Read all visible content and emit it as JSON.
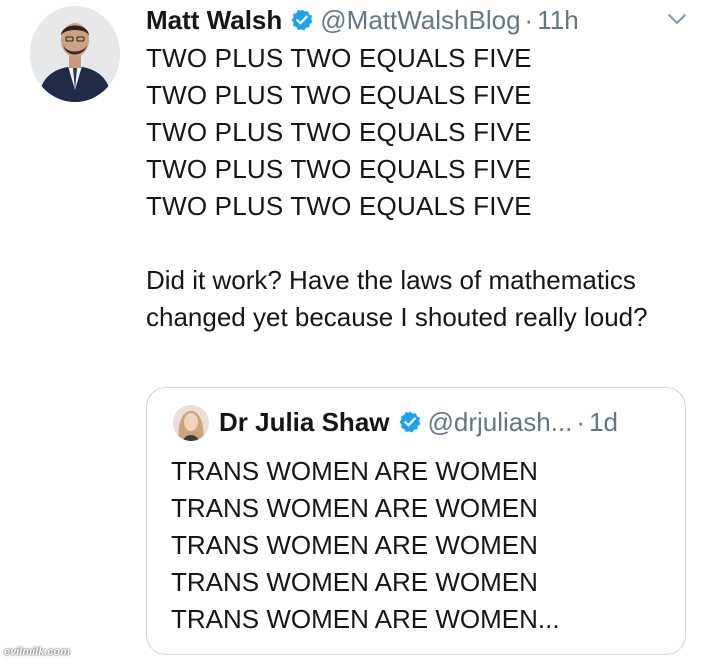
{
  "tweet": {
    "author_name": "Matt Walsh",
    "handle": "@MattWalshBlog",
    "separator": "·",
    "time": "11h",
    "repeated_lines": [
      "TWO PLUS TWO EQUALS FIVE",
      "TWO PLUS TWO EQUALS FIVE",
      "TWO PLUS TWO EQUALS FIVE",
      "TWO PLUS TWO EQUALS FIVE",
      "TWO PLUS TWO EQUALS FIVE"
    ],
    "body": "Did it work? Have the laws of mathematics changed yet because I shouted really loud?",
    "menu_icon": "chevron-down-icon"
  },
  "quoted_tweet": {
    "author_name": "Dr Julia Shaw",
    "handle": "@drjuliash...",
    "separator": "·",
    "time": "1d",
    "lines": [
      "TRANS WOMEN ARE WOMEN",
      "TRANS WOMEN ARE WOMEN",
      "TRANS WOMEN ARE WOMEN",
      "TRANS WOMEN ARE WOMEN",
      "TRANS WOMEN ARE WOMEN..."
    ]
  },
  "watermark": "evilmilk.com",
  "colors": {
    "text": "#14171a",
    "secondary": "#657786",
    "verified": "#1da1f2",
    "border": "#ccd6dd"
  }
}
